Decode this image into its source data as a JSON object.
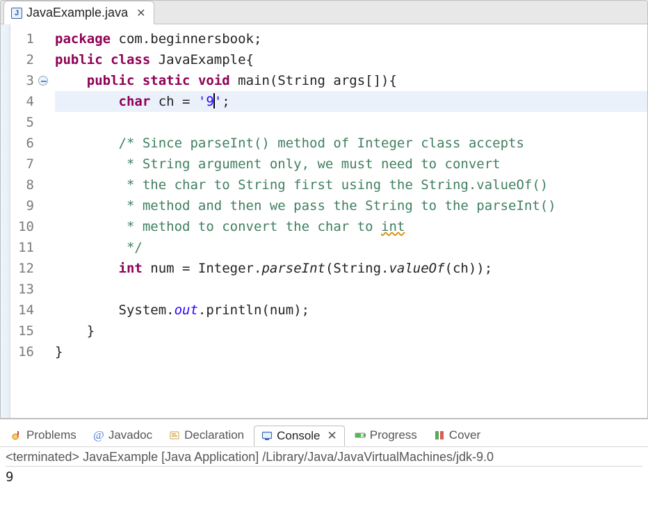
{
  "editor_tab": {
    "filename": "JavaExample.java"
  },
  "code": {
    "lines": [
      {
        "n": "1",
        "tokens": [
          [
            "kw",
            "package"
          ],
          [
            "p",
            " com.beginnersbook;"
          ]
        ]
      },
      {
        "n": "2",
        "tokens": [
          [
            "kw",
            "public"
          ],
          [
            "p",
            " "
          ],
          [
            "kw",
            "class"
          ],
          [
            "p",
            " JavaExample{"
          ]
        ]
      },
      {
        "n": "3",
        "fold": true,
        "tokens": [
          [
            "indent",
            "    "
          ],
          [
            "kw",
            "public"
          ],
          [
            "p",
            " "
          ],
          [
            "kw",
            "static"
          ],
          [
            "p",
            " "
          ],
          [
            "kw",
            "void"
          ],
          [
            "p",
            " main(String args[]){"
          ]
        ]
      },
      {
        "n": "4",
        "hl": true,
        "tokens": [
          [
            "indent",
            "        "
          ],
          [
            "kw",
            "char"
          ],
          [
            "p",
            " ch = "
          ],
          [
            "str",
            "'9"
          ],
          [
            "cursor",
            ""
          ],
          [
            "str",
            "'"
          ],
          [
            "p",
            ";"
          ]
        ]
      },
      {
        "n": "5",
        "tokens": []
      },
      {
        "n": "6",
        "tokens": [
          [
            "indent",
            "        "
          ],
          [
            "cmt",
            "/* Since parseInt() method of Integer class accepts"
          ]
        ]
      },
      {
        "n": "7",
        "tokens": [
          [
            "indent",
            "        "
          ],
          [
            "cmt",
            " * String argument only, we must need to convert"
          ]
        ]
      },
      {
        "n": "8",
        "tokens": [
          [
            "indent",
            "        "
          ],
          [
            "cmt",
            " * the char to String first using the String.valueOf()"
          ]
        ]
      },
      {
        "n": "9",
        "tokens": [
          [
            "indent",
            "        "
          ],
          [
            "cmt",
            " * method and then we pass the String to the parseInt()"
          ]
        ]
      },
      {
        "n": "10",
        "tokens": [
          [
            "indent",
            "        "
          ],
          [
            "cmt",
            " * method to convert the char to "
          ],
          [
            "cmt-warn",
            "int"
          ]
        ]
      },
      {
        "n": "11",
        "tokens": [
          [
            "indent",
            "        "
          ],
          [
            "cmt",
            " */"
          ]
        ]
      },
      {
        "n": "12",
        "tokens": [
          [
            "indent",
            "        "
          ],
          [
            "kw",
            "int"
          ],
          [
            "p",
            " num = Integer."
          ],
          [
            "ital",
            "parseInt"
          ],
          [
            "p",
            "(String."
          ],
          [
            "ital",
            "valueOf"
          ],
          [
            "p",
            "(ch));"
          ]
        ]
      },
      {
        "n": "13",
        "tokens": []
      },
      {
        "n": "14",
        "tokens": [
          [
            "indent",
            "        "
          ],
          [
            "p",
            "System."
          ],
          [
            "ital-blue",
            "out"
          ],
          [
            "p",
            ".println(num);"
          ]
        ]
      },
      {
        "n": "15",
        "tokens": [
          [
            "indent",
            "    "
          ],
          [
            "p",
            "}"
          ]
        ]
      },
      {
        "n": "16",
        "tokens": [
          [
            "p",
            "}"
          ]
        ]
      }
    ]
  },
  "views": {
    "problems": "Problems",
    "javadoc": "Javadoc",
    "declaration": "Declaration",
    "console": "Console",
    "progress": "Progress",
    "coverage": "Cover"
  },
  "console": {
    "status": "<terminated> JavaExample [Java Application] /Library/Java/JavaVirtualMachines/jdk-9.0",
    "output": "9"
  }
}
